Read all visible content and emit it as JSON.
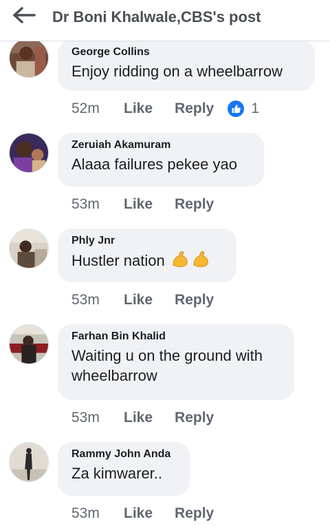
{
  "header": {
    "title": "Dr Boni Khalwale,CBS's post",
    "back_icon": "back-arrow-icon"
  },
  "actions": {
    "like_label": "Like",
    "reply_label": "Reply"
  },
  "comments": [
    {
      "author": "George Collins",
      "text": "Enjoy ridding on a wheelbarrow",
      "time": "52m",
      "reactions": "1"
    },
    {
      "author": "Zeruiah Akamuram",
      "text": "Alaaa failures pekee yao",
      "time": "53m"
    },
    {
      "author": "Phly Jnr",
      "text": "Hustler nation",
      "emoji": "flexed-biceps-icon",
      "time": "53m"
    },
    {
      "author": "Farhan Bin Khalid",
      "text_line1": "Waiting u on the ground with",
      "text_line2": "wheelbarrow",
      "time": "53m"
    },
    {
      "author": "Rammy John Anda",
      "text": "Za kimwarer..",
      "time": "53m"
    }
  ],
  "colors": {
    "bubble": "#f0f2f5",
    "meta": "#606770",
    "like_blue": "#1877f2"
  }
}
